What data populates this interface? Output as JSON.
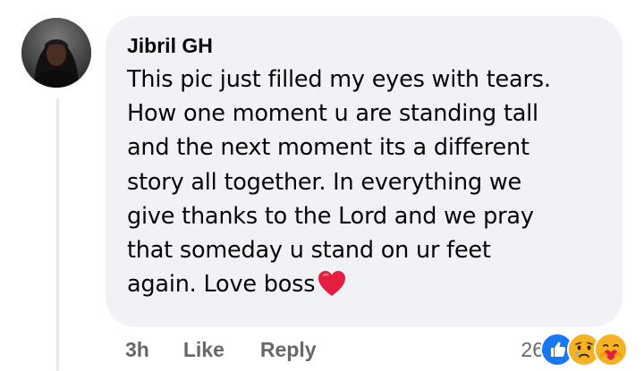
{
  "comment": {
    "author": "Jibril GH",
    "text": "This pic just filled my eyes with tears.\nHow one moment u are standing tall\nand the next moment its a different\nstory all together. In everything we\ngive thanks to the Lord and we pray\nthat someday u stand on ur feet\nagain. Love boss",
    "trailing_emoji": "red-heart-icon"
  },
  "actions": {
    "timestamp": "3h",
    "like_label": "Like",
    "reply_label": "Reply"
  },
  "reactions": {
    "count": "26",
    "icons": [
      "like-reaction-icon",
      "sad-reaction-icon",
      "care-reaction-icon"
    ],
    "colors": {
      "like": "#1877f2",
      "sad": "#f7b125",
      "care": "#f7b125",
      "heart": "#e41e3f"
    }
  }
}
